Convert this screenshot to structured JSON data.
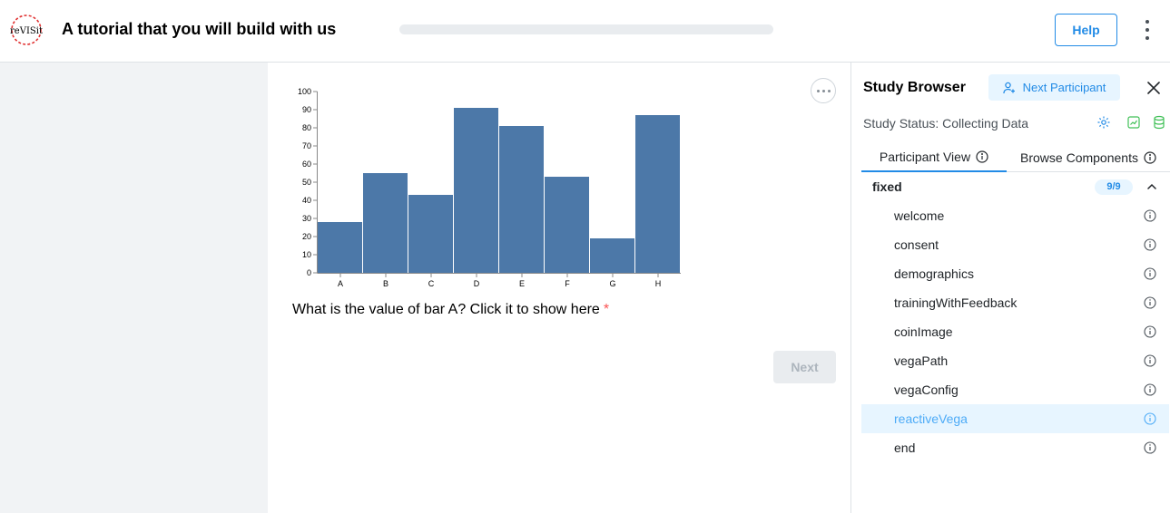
{
  "header": {
    "logo_text": "reVISit",
    "title": "A tutorial that you will build with us",
    "progress_percent": 0,
    "help_label": "Help"
  },
  "main": {
    "question": "What is the value of bar A? Click it to show here",
    "required_marker": "*",
    "next_label": "Next"
  },
  "chart_data": {
    "type": "bar",
    "categories": [
      "A",
      "B",
      "C",
      "D",
      "E",
      "F",
      "G",
      "H"
    ],
    "values": [
      28,
      55,
      43,
      91,
      81,
      53,
      19,
      87
    ],
    "ylim": [
      0,
      100
    ],
    "yticks": [
      0,
      10,
      20,
      30,
      40,
      50,
      60,
      70,
      80,
      90,
      100
    ],
    "bar_color": "#4c78a8",
    "grid": false
  },
  "sidebar": {
    "title": "Study Browser",
    "next_participant_label": "Next Participant",
    "status_text": "Study Status: Collecting Data",
    "tabs": [
      {
        "label": "Participant View",
        "active": true
      },
      {
        "label": "Browse Components",
        "active": false
      }
    ],
    "group": {
      "label": "fixed",
      "count": "9/9",
      "items": [
        {
          "label": "welcome",
          "active": false
        },
        {
          "label": "consent",
          "active": false
        },
        {
          "label": "demographics",
          "active": false
        },
        {
          "label": "trainingWithFeedback",
          "active": false
        },
        {
          "label": "coinImage",
          "active": false
        },
        {
          "label": "vegaPath",
          "active": false
        },
        {
          "label": "vegaConfig",
          "active": false
        },
        {
          "label": "reactiveVega",
          "active": true
        },
        {
          "label": "end",
          "active": false
        }
      ]
    }
  },
  "colors": {
    "accent": "#228be6",
    "required": "#fa5252",
    "status_icon_gear": "#228be6",
    "status_icon_green": "#40c057"
  }
}
